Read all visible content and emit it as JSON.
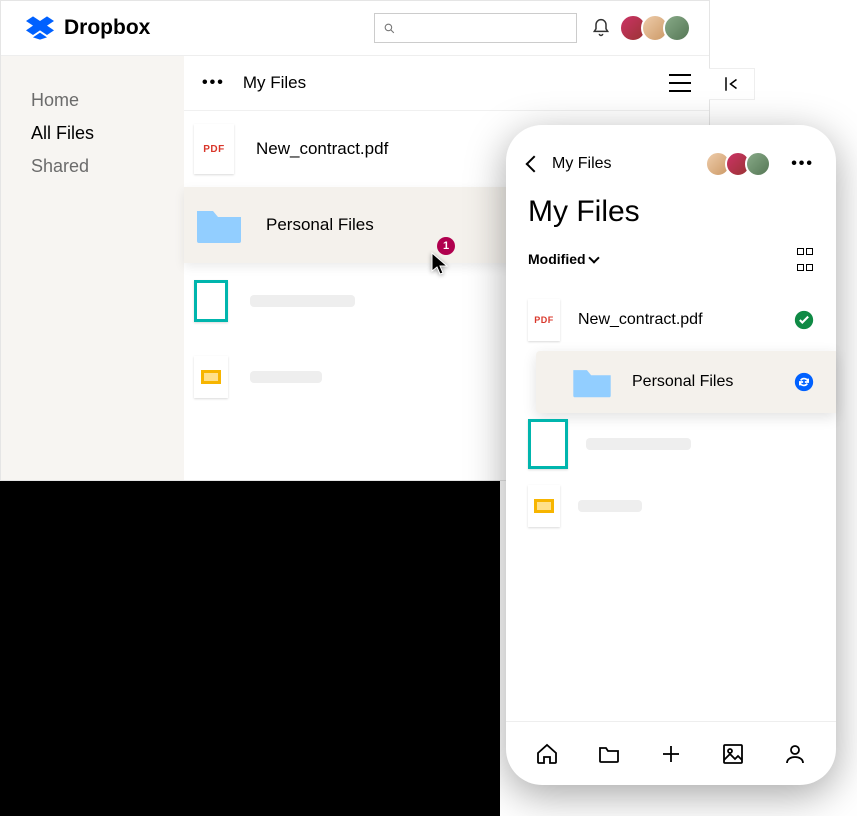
{
  "brand": {
    "name": "Dropbox"
  },
  "sidebar": {
    "items": [
      {
        "label": "Home"
      },
      {
        "label": "All Files"
      },
      {
        "label": "Shared"
      }
    ],
    "active_index": 1
  },
  "desktop": {
    "breadcrumb": "My Files",
    "files": [
      {
        "name": "New_contract.pdf",
        "type": "pdf",
        "icon_label": "PDF"
      },
      {
        "name": "Personal Files",
        "type": "folder"
      },
      {
        "name": "",
        "type": "image"
      },
      {
        "name": "",
        "type": "slides"
      }
    ]
  },
  "cursor": {
    "badge_count": "1"
  },
  "mobile": {
    "back_crumb": "My Files",
    "title": "My Files",
    "sort": {
      "label": "Modified"
    },
    "files": [
      {
        "name": "New_contract.pdf",
        "type": "pdf",
        "icon_label": "PDF",
        "status": "synced"
      },
      {
        "name": "Personal Files",
        "type": "folder",
        "status": "syncing"
      },
      {
        "name": "",
        "type": "image"
      },
      {
        "name": "",
        "type": "slides"
      }
    ]
  }
}
